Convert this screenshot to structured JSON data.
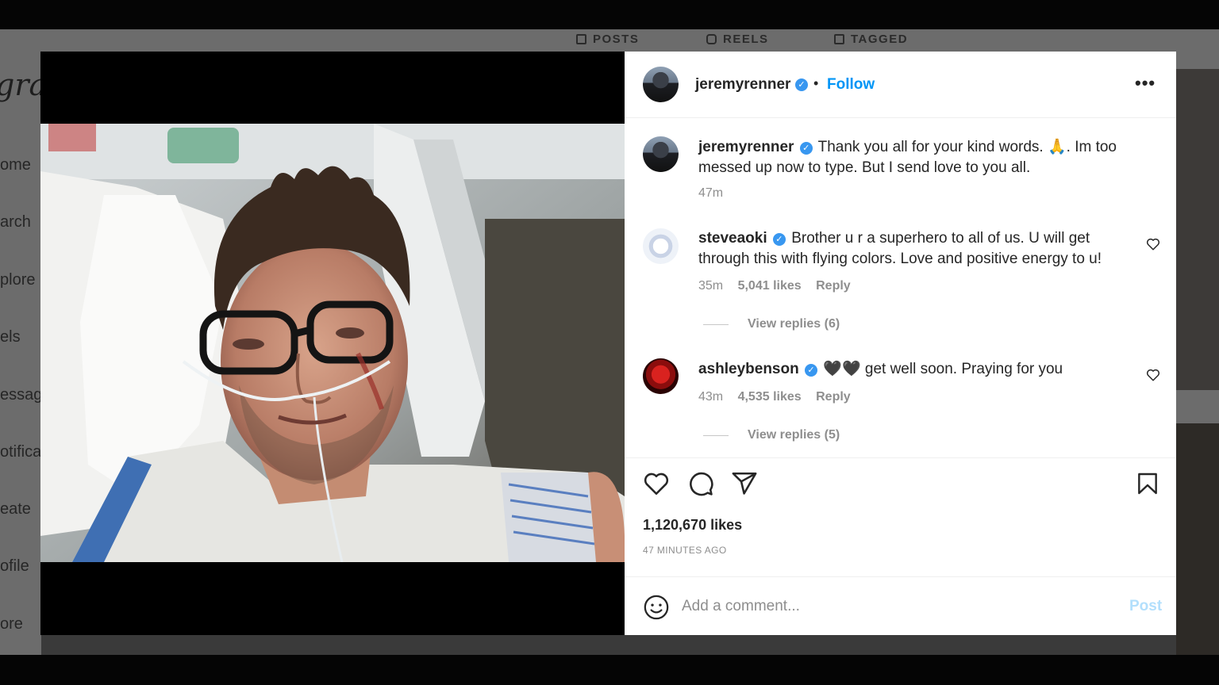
{
  "background": {
    "profile_tabs": [
      "POSTS",
      "REELS",
      "TAGGED"
    ],
    "logo_fragment": "gram",
    "side_nav": [
      "ome",
      "arch",
      "plore",
      "els",
      "essag",
      "otifica",
      "eate",
      "ofile",
      "ore"
    ]
  },
  "post": {
    "author": {
      "username": "jeremyrenner",
      "verified": true
    },
    "follow_label": "Follow",
    "more_label": "•••",
    "caption": {
      "username": "jeremyrenner",
      "text": "Thank you all for your kind words. 🙏. Im too messed up now to type. But I send love to you all.",
      "time": "47m"
    },
    "comments": [
      {
        "username": "steveaoki",
        "text": "Brother u r a superhero to all of us. U will get through this with flying colors. Love and positive energy to u!",
        "time": "35m",
        "likes": "5,041 likes",
        "reply_label": "Reply",
        "view_replies": "View replies (6)"
      },
      {
        "username": "ashleybenson",
        "text": "🖤🖤 get well soon. Praying for you",
        "time": "43m",
        "likes": "4,535 likes",
        "reply_label": "Reply",
        "view_replies": "View replies (5)"
      }
    ],
    "like_count": "1,120,670 likes",
    "time_ago": "47 MINUTES AGO",
    "composer": {
      "placeholder": "Add a comment...",
      "post_label": "Post"
    }
  },
  "colors": {
    "accent": "#0095f6",
    "verified": "#3897f0",
    "text": "#262626",
    "muted": "#8e8e8e"
  },
  "icons": [
    "heart-icon",
    "comment-icon",
    "share-icon",
    "bookmark-icon",
    "emoji-icon",
    "verified-badge-icon",
    "more-options-icon"
  ]
}
